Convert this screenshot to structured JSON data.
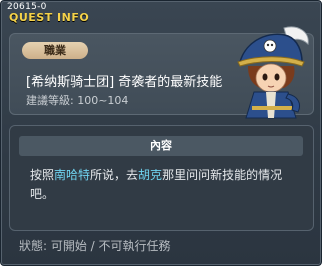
{
  "window": {
    "quest_id": "20615-0",
    "title": "QUEST INFO"
  },
  "header": {
    "job_label": "職業",
    "quest_name": "[希纳斯骑士团] 奇袭者的最新技能",
    "level_range": "建議等級: 100~104"
  },
  "content": {
    "heading": "內容",
    "text_parts": {
      "p1": "按照",
      "npc1": "南哈特",
      "p2": "所说，去",
      "npc2": "胡克",
      "p3": "那里问问新技能的情况吧。"
    },
    "highlight_color": "#6fd3f0"
  },
  "footer": {
    "status": "狀態: 可開始 / 不可執行任務"
  },
  "icons": {
    "portrait": "character-portrait-icon"
  }
}
